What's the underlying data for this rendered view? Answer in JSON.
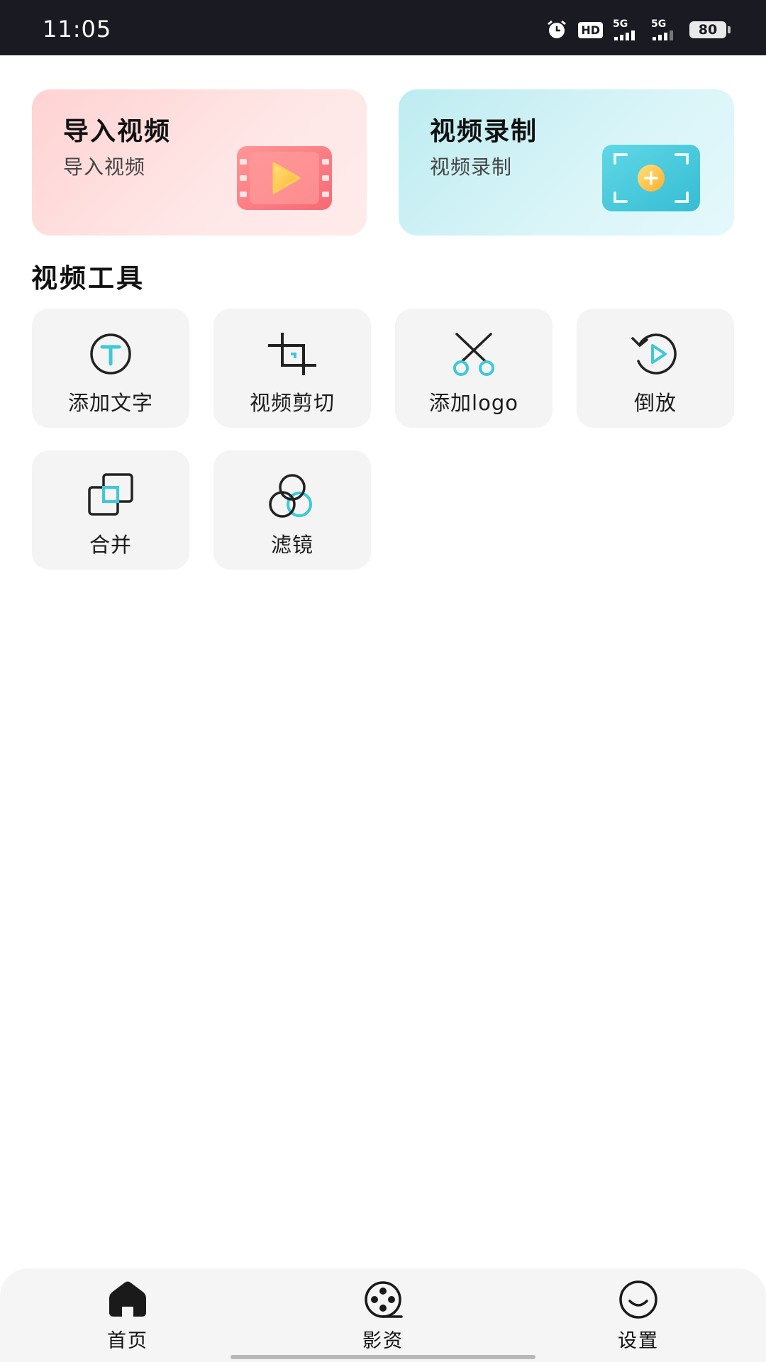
{
  "status_bar": {
    "time": "11:05",
    "hd_label": "HD",
    "network_1": "5G",
    "network_2": "5G",
    "battery": "80"
  },
  "cards": {
    "import": {
      "title": "导入视频",
      "subtitle": "导入视频"
    },
    "record": {
      "title": "视频录制",
      "subtitle": "视频录制"
    }
  },
  "tools_section": {
    "title": "视频工具",
    "items": [
      {
        "label": "添加文字",
        "icon": "text-icon"
      },
      {
        "label": "视频剪切",
        "icon": "crop-icon"
      },
      {
        "label": "添加logo",
        "icon": "scissors-icon"
      },
      {
        "label": "倒放",
        "icon": "reverse-play-icon"
      },
      {
        "label": "合并",
        "icon": "merge-icon"
      },
      {
        "label": "滤镜",
        "icon": "filter-icon"
      }
    ]
  },
  "bottom_nav": {
    "items": [
      {
        "label": "首页",
        "icon": "home-icon"
      },
      {
        "label": "影资",
        "icon": "film-reel-icon"
      },
      {
        "label": "设置",
        "icon": "smile-icon"
      }
    ]
  },
  "colors": {
    "accent": "#3ec9d6",
    "status_bar": "#191a22",
    "import_card": "#ffd6d6",
    "record_card": "#cdf1f5",
    "tile": "#f4f4f4"
  }
}
